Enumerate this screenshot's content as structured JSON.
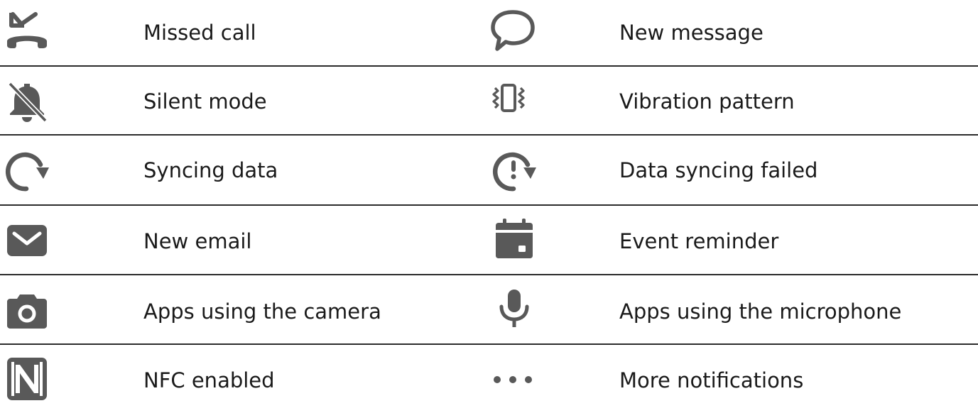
{
  "table": {
    "rows": [
      {
        "left": {
          "icon": "missed-call-icon",
          "label": "Missed call"
        },
        "right": {
          "icon": "new-message-icon",
          "label": "New message"
        }
      },
      {
        "left": {
          "icon": "silent-mode-icon",
          "label": "Silent mode"
        },
        "right": {
          "icon": "vibration-icon",
          "label": "Vibration pattern"
        }
      },
      {
        "left": {
          "icon": "syncing-data-icon",
          "label": "Syncing data"
        },
        "right": {
          "icon": "sync-failed-icon",
          "label": "Data syncing failed"
        }
      },
      {
        "left": {
          "icon": "email-icon",
          "label": "New email"
        },
        "right": {
          "icon": "calendar-icon",
          "label": "Event reminder"
        }
      },
      {
        "left": {
          "icon": "camera-icon",
          "label": "Apps using the camera"
        },
        "right": {
          "icon": "microphone-icon",
          "label": "Apps using the microphone"
        }
      },
      {
        "left": {
          "icon": "nfc-icon",
          "label": "NFC enabled"
        },
        "right": {
          "icon": "more-dots-icon",
          "label": "More notifications"
        }
      }
    ]
  },
  "colors": {
    "icon": "#595959",
    "text": "#1a1a1a",
    "divider": "#2b2b2b"
  }
}
